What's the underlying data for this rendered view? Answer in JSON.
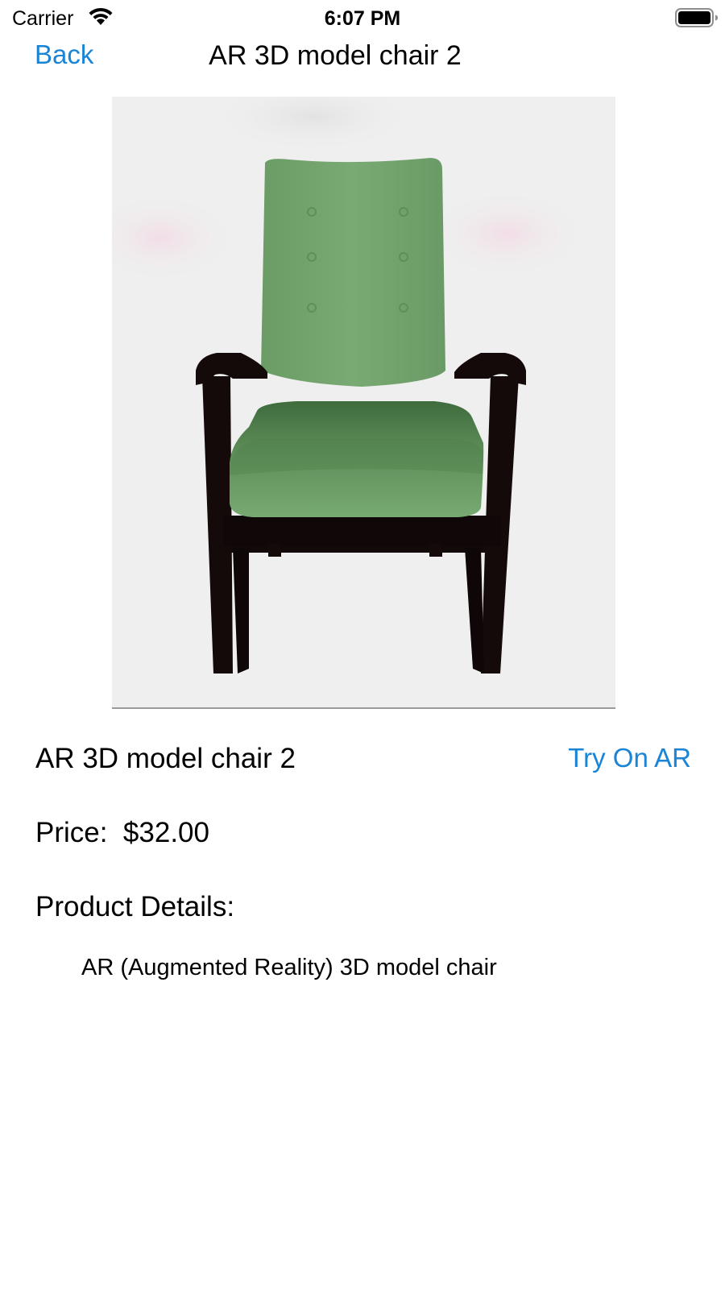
{
  "status_bar": {
    "carrier": "Carrier",
    "time": "6:07 PM",
    "icons": [
      "wifi-icon",
      "battery-icon"
    ]
  },
  "nav": {
    "back_label": "Back",
    "title": "AR 3D model chair 2"
  },
  "product": {
    "image_icon": "chair-image",
    "name": "AR 3D model chair 2",
    "try_ar_label": "Try On AR",
    "price_label": "Price:",
    "price_value": "$32.00",
    "details_heading": "Product Details:",
    "details_text": "AR (Augmented Reality) 3D model chair"
  },
  "colors": {
    "accent": "#1a84d6",
    "chair_fabric": "#75a870",
    "chair_frame": "#140a0a",
    "image_background": "#efefef"
  }
}
